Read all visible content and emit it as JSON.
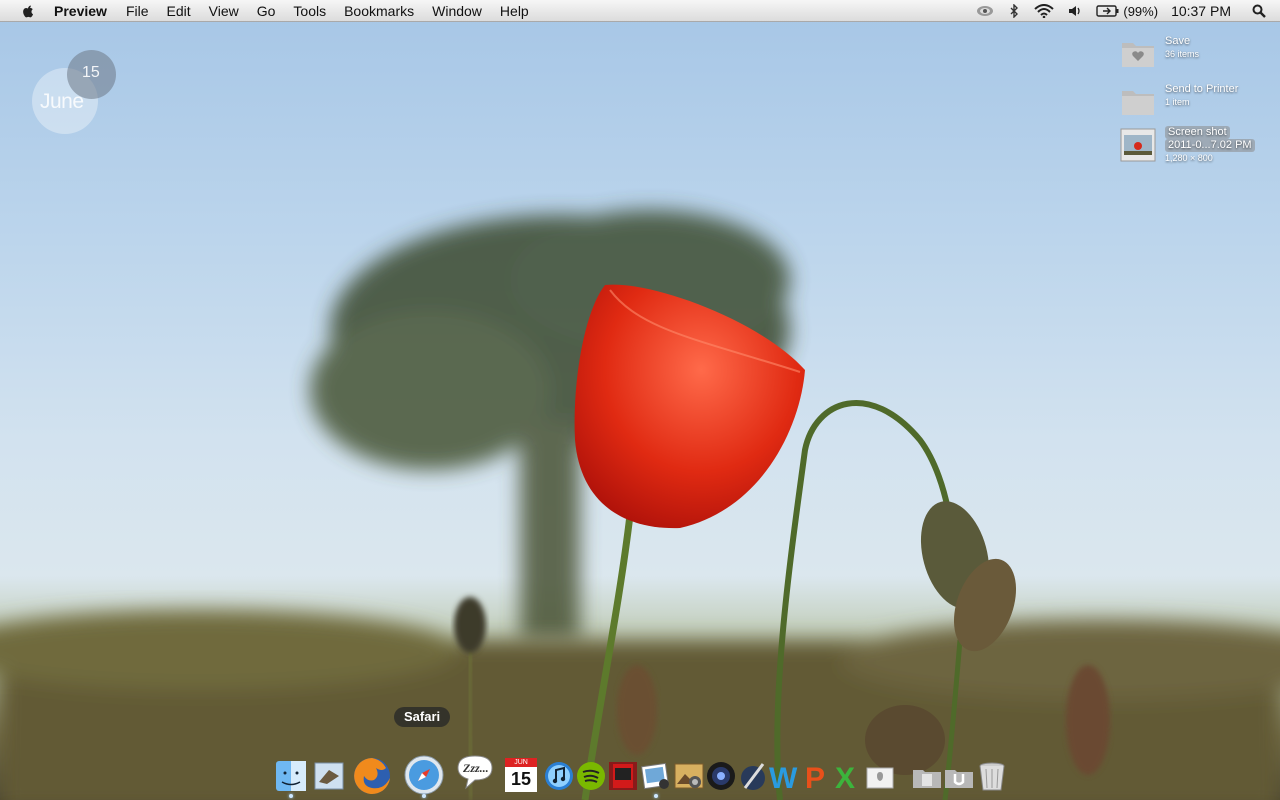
{
  "menubar": {
    "app_name": "Preview",
    "items": [
      "File",
      "Edit",
      "View",
      "Go",
      "Tools",
      "Bookmarks",
      "Window",
      "Help"
    ],
    "battery_percent": "(99%)",
    "clock": "10:37 PM",
    "status_icons": [
      "eye-icon",
      "bluetooth-icon",
      "wifi-icon",
      "volume-icon",
      "battery-icon",
      "spotlight-icon"
    ]
  },
  "calendar_widget": {
    "month": "June",
    "day": "15"
  },
  "desktop_items": [
    {
      "name": "Save",
      "sub": "36 items",
      "icon": "folder-heart-icon"
    },
    {
      "name": "Send to Printer",
      "sub": "1 item",
      "icon": "folder-icon"
    },
    {
      "name_line1": "Screen shot",
      "name_line2": "2011-0...7.02 PM",
      "sub": "1,280 × 800",
      "icon": "screenshot-thumbnail"
    }
  ],
  "dock": {
    "tooltip": "Safari",
    "calendar_day": "15",
    "calendar_month": "JUN",
    "apps": [
      "finder-icon",
      "mail-icon",
      "firefox-icon",
      "safari-icon",
      "adium-icon",
      "ical-icon",
      "itunes-icon",
      "spotify-icon",
      "photo-booth-icon",
      "iphoto-icon",
      "image-capture-icon",
      "aperture-icon",
      "textedit-icon",
      "word-icon",
      "powerpoint-icon",
      "excel-icon",
      "app-store-icon",
      "documents-stack-icon",
      "downloads-stack-icon",
      "trash-icon"
    ]
  }
}
